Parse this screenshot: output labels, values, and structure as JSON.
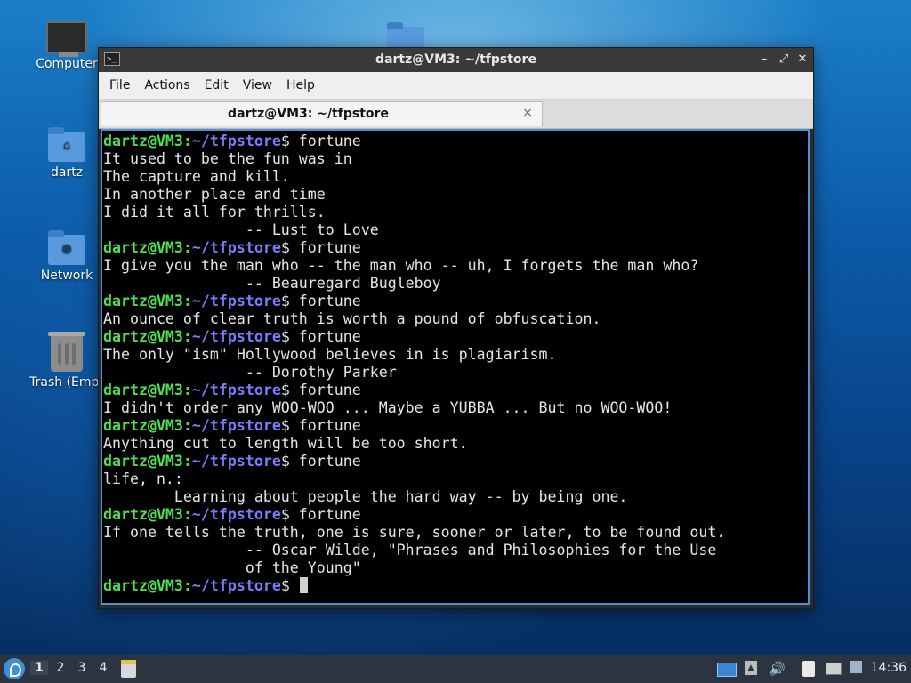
{
  "desktop": {
    "icons": [
      {
        "label": "Computer",
        "icon": "monitor-icon"
      },
      {
        "label": "dartz",
        "icon": "home-folder-icon"
      },
      {
        "label": "Network",
        "icon": "network-folder-icon"
      },
      {
        "label": "Trash (Empt",
        "icon": "trash-icon"
      }
    ],
    "top_folder_icon": "folder-icon"
  },
  "window": {
    "title": "dartz@VM3: ~/tfpstore",
    "controls": {
      "minimize": "minimize-icon",
      "maximize": "maximize-icon",
      "close": "close-icon"
    },
    "menu": [
      "File",
      "Actions",
      "Edit",
      "View",
      "Help"
    ],
    "tab": {
      "label": "dartz@VM3: ~/tfpstore",
      "close_icon": "×"
    }
  },
  "terminal": {
    "prompt_user": "dartz@VM3",
    "prompt_sep": ":",
    "prompt_path": "~/tfpstore",
    "prompt_end": "$ ",
    "lines": [
      {
        "type": "prompt",
        "cmd": "fortune"
      },
      {
        "type": "out",
        "text": "It used to be the fun was in"
      },
      {
        "type": "out",
        "text": "The capture and kill."
      },
      {
        "type": "out",
        "text": "In another place and time"
      },
      {
        "type": "out",
        "text": "I did it all for thrills."
      },
      {
        "type": "out",
        "text": "                -- Lust to Love"
      },
      {
        "type": "prompt",
        "cmd": "fortune"
      },
      {
        "type": "out",
        "text": "I give you the man who -- the man who -- uh, I forgets the man who?"
      },
      {
        "type": "out",
        "text": "                -- Beauregard Bugleboy"
      },
      {
        "type": "prompt",
        "cmd": "fortune"
      },
      {
        "type": "out",
        "text": "An ounce of clear truth is worth a pound of obfuscation."
      },
      {
        "type": "prompt",
        "cmd": "fortune"
      },
      {
        "type": "out",
        "text": "The only \"ism\" Hollywood believes in is plagiarism."
      },
      {
        "type": "out",
        "text": "                -- Dorothy Parker"
      },
      {
        "type": "prompt",
        "cmd": "fortune"
      },
      {
        "type": "out",
        "text": "I didn't order any WOO-WOO ... Maybe a YUBBA ... But no WOO-WOO!"
      },
      {
        "type": "prompt",
        "cmd": "fortune"
      },
      {
        "type": "out",
        "text": "Anything cut to length will be too short."
      },
      {
        "type": "prompt",
        "cmd": "fortune"
      },
      {
        "type": "out",
        "text": "life, n.:"
      },
      {
        "type": "out",
        "text": "        Learning about people the hard way -- by being one."
      },
      {
        "type": "prompt",
        "cmd": "fortune"
      },
      {
        "type": "out",
        "text": "If one tells the truth, one is sure, sooner or later, to be found out."
      },
      {
        "type": "out",
        "text": "                -- Oscar Wilde, \"Phrases and Philosophies for the Use"
      },
      {
        "type": "out",
        "text": "                of the Young\""
      },
      {
        "type": "prompt",
        "cmd": "",
        "cursor": true
      }
    ]
  },
  "taskbar": {
    "workspaces": [
      "1",
      "2",
      "3",
      "4"
    ],
    "active_workspace": "1",
    "clock": "14:36"
  }
}
